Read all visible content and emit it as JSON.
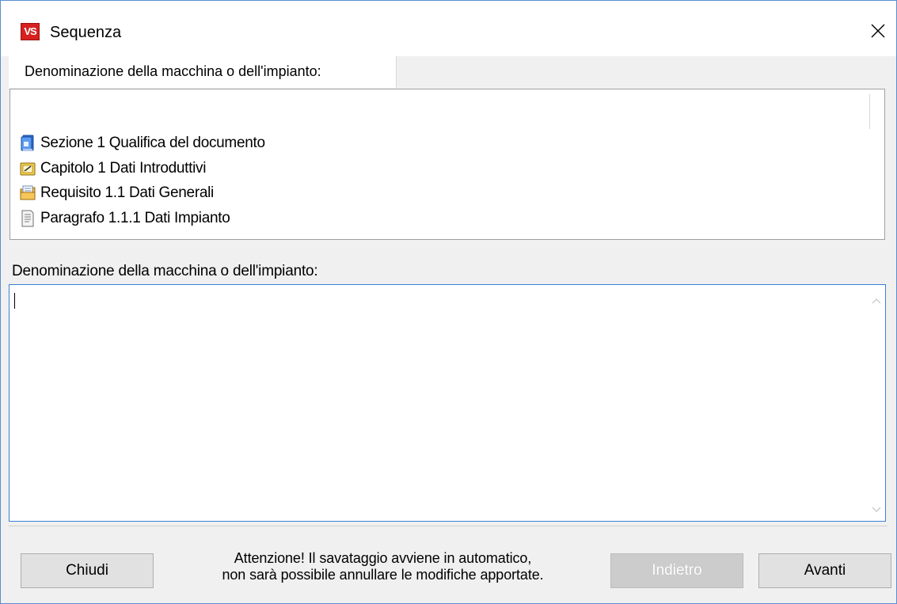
{
  "window": {
    "title": "Sequenza",
    "app_icon_text": "VS",
    "close_glyph": "×"
  },
  "tab": {
    "label": "Denominazione della macchina o dell'impianto:"
  },
  "tree": {
    "items": [
      {
        "label": "Sezione 1 Qualifica del documento",
        "icon": "section-book-icon"
      },
      {
        "label": "Capitolo 1 Dati Introduttivi",
        "icon": "chapter-folder-icon"
      },
      {
        "label": "Requisito 1.1 Dati Generali",
        "icon": "requirement-folder-icon"
      },
      {
        "label": "Paragrafo 1.1.1 Dati Impianto",
        "icon": "paragraph-document-icon"
      }
    ]
  },
  "field": {
    "label": "Denominazione della macchina o dell'impianto:",
    "value": ""
  },
  "footer": {
    "close_label": "Chiudi",
    "notice_line1": "Attenzione! Il savataggio avviene in automatico,",
    "notice_line2": "non sarà possibile annullare le modifiche apportate.",
    "back_label": "Indietro",
    "back_enabled": false,
    "next_label": "Avanti"
  },
  "colors": {
    "accent_border": "#3c7fd6",
    "app_icon_red": "#d6211f"
  }
}
